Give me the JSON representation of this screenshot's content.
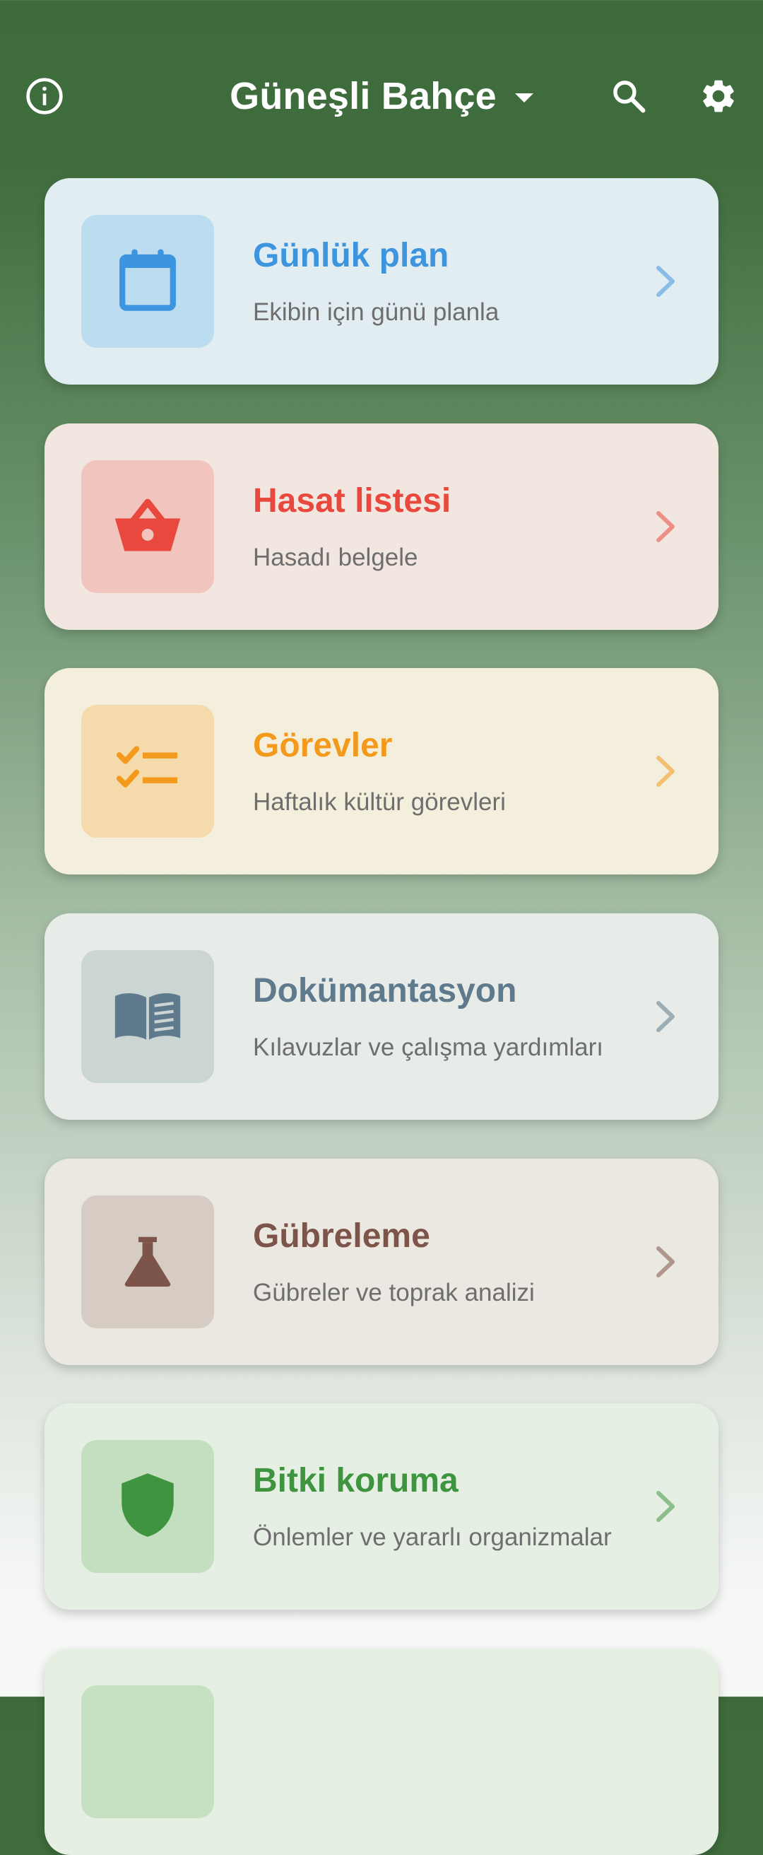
{
  "header": {
    "title": "Güneşli Bahçe",
    "info_icon": "info-circle-icon",
    "dropdown_icon": "caret-down-icon",
    "search_icon": "search-icon",
    "settings_icon": "gear-icon"
  },
  "cards": [
    {
      "title": "Günlük plan",
      "subtitle": "Ekibin için günü planla",
      "icon": "calendar-icon",
      "accent": "#3d95e0",
      "bg": "#e2edf1",
      "tile_bg": "#bcdcef"
    },
    {
      "title": "Hasat listesi",
      "subtitle": "Hasadı belgele",
      "icon": "basket-icon",
      "accent": "#e8483e",
      "bg": "#f2e7e0",
      "tile_bg": "#f1c5bd"
    },
    {
      "title": "Görevler",
      "subtitle": "Haftalık kültür görevleri",
      "icon": "checklist-icon",
      "accent": "#f39a1c",
      "bg": "#f4eedc",
      "tile_bg": "#f5dbab"
    },
    {
      "title": "Dokümantasyon",
      "subtitle": "Kılavuzlar ve çalışma yardımları",
      "icon": "book-icon",
      "accent": "#5e7a8c",
      "bg": "#e7ece9",
      "tile_bg": "#cbd5d4"
    },
    {
      "title": "Gübreleme",
      "subtitle": "Gübreler ve toprak analizi",
      "icon": "flask-icon",
      "accent": "#7d5449",
      "bg": "#eae8e1",
      "tile_bg": "#d7ccc3"
    },
    {
      "title": "Bitki koruma",
      "subtitle": "Önlemler ve yararlı organizmalar",
      "icon": "shield-icon",
      "accent": "#3f953f",
      "bg": "#e6efe3",
      "tile_bg": "#c3dfc0"
    },
    {
      "title": "",
      "subtitle": "",
      "icon": "",
      "accent": "#3f953f",
      "bg": "#e5efe2",
      "tile_bg": "#c5e1c2"
    }
  ]
}
